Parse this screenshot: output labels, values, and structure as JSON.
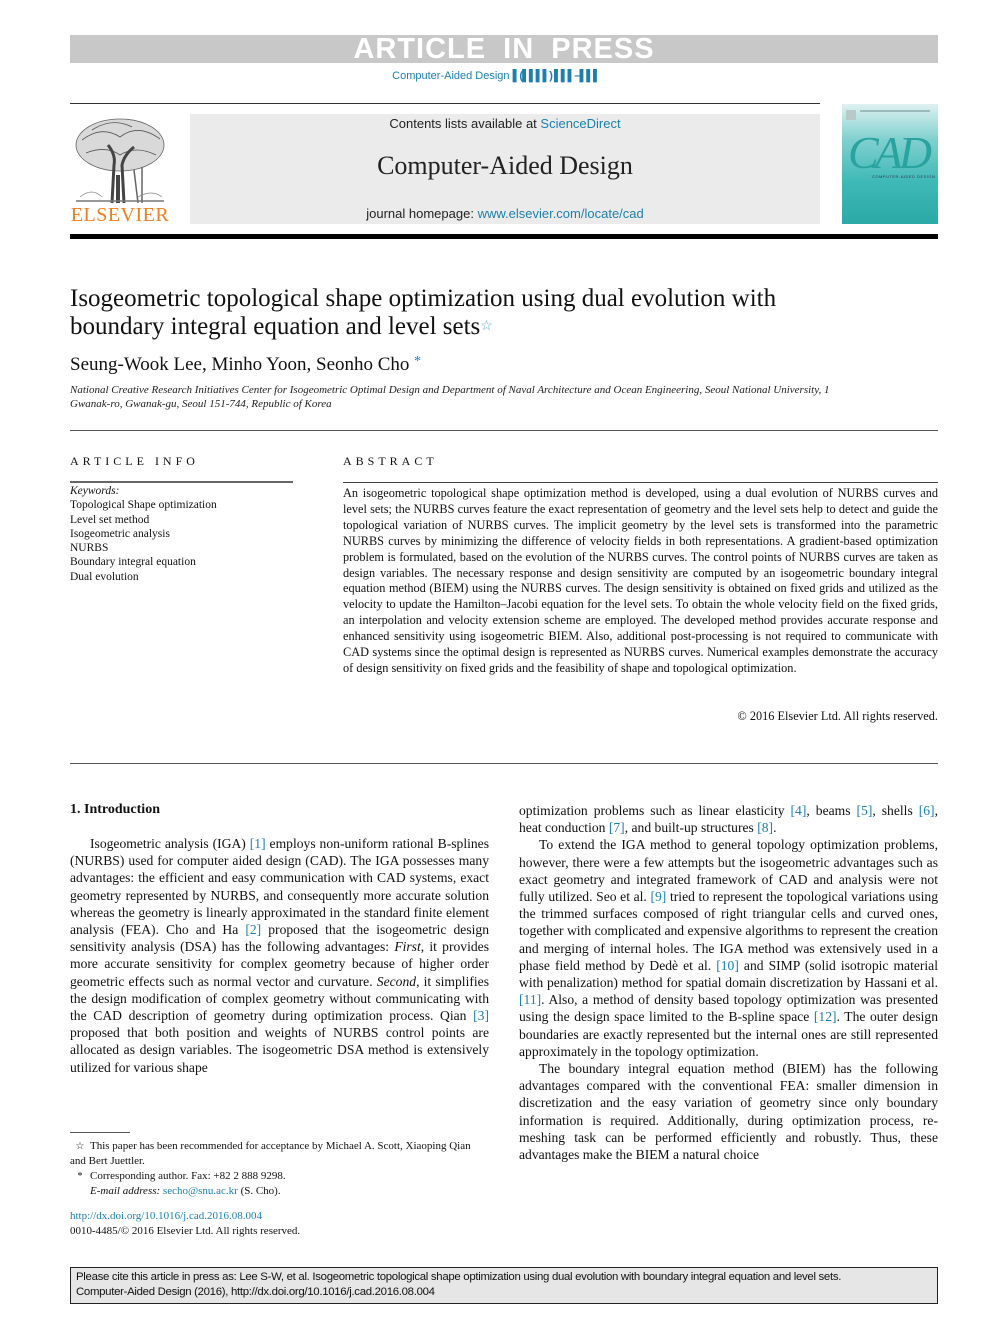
{
  "banner": {
    "article_in_press": "ARTICLE IN PRESS",
    "journal_ref": "Computer-Aided Design",
    "journal_ref_placeholder": "▌(▌▌▌▌) ▌▌▌–▌▌▌"
  },
  "masthead": {
    "publisher": "ELSEVIER",
    "contents_prefix": "Contents lists available at ",
    "contents_link": "ScienceDirect",
    "journal_title": "Computer-Aided Design",
    "homepage_prefix": "journal homepage: ",
    "homepage_link": "www.elsevier.com/locate/cad",
    "cover_title": "CAD",
    "cover_subtitle": "COMPUTER-AIDED DESIGN"
  },
  "article": {
    "title": "Isogeometric topological shape optimization using dual evolution with boundary integral equation and level sets",
    "title_mark": "☆",
    "authors": "Seung-Wook Lee, Minho Yoon, Seonho Cho",
    "author_mark": "*",
    "affiliation": "National Creative Research Initiatives Center for Isogeometric Optimal Design and Department of Naval Architecture and Ocean Engineering, Seoul National University, 1 Gwanak-ro, Gwanak-gu, Seoul 151-744, Republic of Korea"
  },
  "article_info": {
    "heading": "ARTICLE INFO",
    "keywords_label": "Keywords:",
    "keywords": [
      "Topological Shape optimization",
      "Level set method",
      "Isogeometric analysis",
      "NURBS",
      "Boundary integral equation",
      "Dual evolution"
    ]
  },
  "abstract": {
    "heading": "ABSTRACT",
    "text": "An isogeometric topological shape optimization method is developed, using a dual evolution of NURBS curves and level sets; the NURBS curves feature the exact representation of geometry and the level sets help to detect and guide the topological variation of NURBS curves. The implicit geometry by the level sets is transformed into the parametric NURBS curves by minimizing the difference of velocity fields in both representations. A gradient-based optimization problem is formulated, based on the evolution of the NURBS curves. The control points of NURBS curves are taken as design variables. The necessary response and design sensitivity are computed by an isogeometric boundary integral equation method (BIEM) using the NURBS curves. The design sensitivity is obtained on fixed grids and utilized as the velocity to update the Hamilton–Jacobi equation for the level sets. To obtain the whole velocity field on the fixed grids, an interpolation and velocity extension scheme are employed. The developed method provides accurate response and enhanced sensitivity using isogeometric BIEM. Also, additional post-processing is not required to communicate with CAD systems since the optimal design is represented as NURBS curves. Numerical examples demonstrate the accuracy of design sensitivity on fixed grids and the feasibility of shape and topological optimization.",
    "copyright": "© 2016 Elsevier Ltd. All rights reserved."
  },
  "body": {
    "section1_heading": "1.  Introduction",
    "left_p1": [
      {
        "t": "Isogeometric analysis (IGA) "
      },
      {
        "r": "[1]"
      },
      {
        "t": " employs non-uniform rational B-splines (NURBS) used for computer aided design (CAD). The IGA possesses many advantages: the efficient and easy communication with CAD systems, exact geometry represented by NURBS, and consequently more accurate solution whereas the geometry is linearly approximated in the standard finite element analysis (FEA). Cho and Ha "
      },
      {
        "r": "[2]"
      },
      {
        "t": " proposed that the isogeometric design sensitivity analysis (DSA) has the following advantages: "
      },
      {
        "i": "First"
      },
      {
        "t": ", it provides more accurate sensitivity for complex geometry because of higher order geometric effects such as normal vector and curvature. "
      },
      {
        "i": "Second"
      },
      {
        "t": ", it simplifies the design modification of complex geometry without communicating with the CAD description of geometry during optimization process. Qian "
      },
      {
        "r": "[3]"
      },
      {
        "t": " proposed that both position and weights of NURBS control points are allocated as design variables. The isogeometric DSA method is extensively utilized for various shape"
      }
    ],
    "right_p0": [
      {
        "t": "optimization problems such as linear elasticity "
      },
      {
        "r": "[4]"
      },
      {
        "t": ", beams "
      },
      {
        "r": "[5]"
      },
      {
        "t": ", shells "
      },
      {
        "r": "[6]"
      },
      {
        "t": ", heat conduction "
      },
      {
        "r": "[7]"
      },
      {
        "t": ", and built-up structures "
      },
      {
        "r": "[8]"
      },
      {
        "t": "."
      }
    ],
    "right_p1": [
      {
        "t": "To extend the IGA method to general topology optimization problems, however, there were a few attempts but the isogeometric advantages such as exact geometry and integrated framework of CAD and analysis were not fully utilized. Seo et al. "
      },
      {
        "r": "[9]"
      },
      {
        "t": " tried to represent the topological variations using the trimmed surfaces composed of right triangular cells and curved ones, together with complicated and expensive algorithms to represent the creation and merging of internal holes. The IGA method was extensively used in a phase field method by Dedè et al. "
      },
      {
        "r": "[10]"
      },
      {
        "t": " and SIMP (solid isotropic material with penalization) method for spatial domain discretization by Hassani et al. "
      },
      {
        "r": "[11]"
      },
      {
        "t": ". Also, a method of density based topology optimization was presented using the design space limited to the B-spline space "
      },
      {
        "r": "[12]"
      },
      {
        "t": ". The outer design boundaries are exactly represented but the internal ones are still represented approximately in the topology optimization."
      }
    ],
    "right_p2": [
      {
        "t": "The boundary integral equation method (BIEM) has the following advantages compared with the conventional FEA: smaller dimension in discretization and the easy variation of geometry since only boundary information is required. Additionally, during optimization process, re-meshing task can be performed efficiently and robustly. Thus, these advantages make the BIEM a natural choice"
      }
    ]
  },
  "footnotes": {
    "star_mark": "☆",
    "star_note": "This paper has been recommended for acceptance by Michael A. Scott, Xiaoping Qian and Bert Juettler.",
    "corr_mark": "*",
    "corr_note": "Corresponding author. Fax: +82 2 888 9298.",
    "email_label": "E-mail address:",
    "email": "secho@snu.ac.kr",
    "email_suffix": " (S. Cho).",
    "doi": "http://dx.doi.org/10.1016/j.cad.2016.08.004",
    "issn": "0010-4485/© 2016 Elsevier Ltd. All rights reserved."
  },
  "cite": {
    "line1": "Please cite this article in press as: Lee S-W, et al. Isogeometric topological shape optimization using dual evolution with boundary integral equation and level sets.",
    "line2": "Computer-Aided Design (2016), http://dx.doi.org/10.1016/j.cad.2016.08.004"
  },
  "colors": {
    "link": "#1c7fae",
    "elsevier_orange": "#f07e1b",
    "banner_gray": "#c8c8c8",
    "masthead_gray": "#ebebeb",
    "cover_teal": "#2aa9a7"
  }
}
